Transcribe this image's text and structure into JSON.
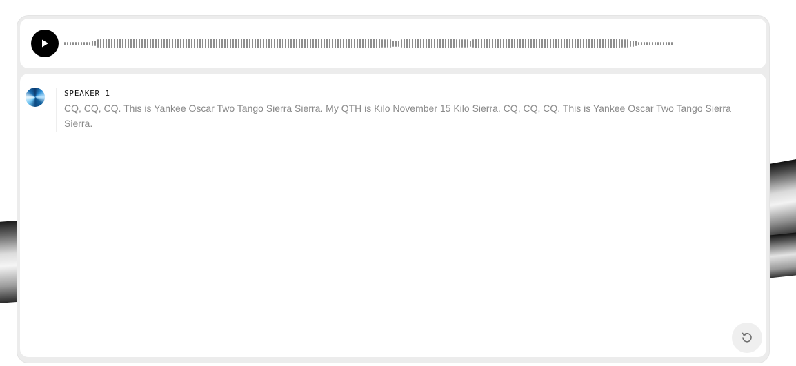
{
  "player": {
    "play_icon": "play-icon",
    "waveform": {
      "description_levels": [
        3,
        3,
        3,
        3,
        3,
        3,
        3,
        3,
        3,
        3,
        5,
        5,
        8,
        9,
        9,
        9,
        9,
        9,
        9,
        9,
        9,
        9,
        9,
        9,
        9,
        9,
        9,
        9,
        9,
        9,
        9,
        9,
        9,
        9,
        9,
        9,
        9,
        9,
        9,
        9,
        9,
        9,
        9,
        9,
        9,
        9,
        9,
        9,
        9,
        9,
        9,
        9,
        9,
        9,
        9,
        9,
        9,
        9,
        9,
        9,
        9,
        9,
        9,
        9,
        9,
        9,
        9,
        9,
        9,
        9,
        9,
        9,
        9,
        9,
        9,
        9,
        9,
        9,
        9,
        9,
        9,
        9,
        9,
        9,
        9,
        9,
        9,
        9,
        9,
        9,
        9,
        9,
        9,
        9,
        9,
        9,
        9,
        9,
        9,
        9,
        9,
        9,
        9,
        9,
        9,
        9,
        9,
        9,
        9,
        9,
        9,
        9,
        9,
        9,
        9,
        8,
        8,
        8,
        8,
        6,
        6,
        6,
        8,
        9,
        9,
        9,
        9,
        9,
        9,
        9,
        9,
        9,
        9,
        9,
        9,
        9,
        9,
        9,
        9,
        9,
        9,
        9,
        8,
        8,
        8,
        8,
        8,
        6,
        8,
        9,
        9,
        9,
        9,
        9,
        9,
        9,
        9,
        9,
        9,
        9,
        9,
        9,
        9,
        9,
        9,
        9,
        9,
        9,
        9,
        9,
        9,
        9,
        9,
        9,
        9,
        9,
        9,
        9,
        9,
        9,
        9,
        9,
        9,
        9,
        9,
        9,
        9,
        9,
        9,
        9,
        9,
        9,
        9,
        9,
        9,
        9,
        9,
        9,
        9,
        9,
        9,
        9,
        8,
        8,
        8,
        6,
        6,
        5,
        3,
        3,
        3,
        3,
        3,
        3,
        3,
        3,
        3,
        3,
        3,
        3,
        3
      ]
    }
  },
  "transcript": {
    "segments": [
      {
        "speaker": "SPEAKER 1",
        "text": "CQ, CQ, CQ. This is Yankee Oscar Two Tango Sierra Sierra. My QTH is Kilo November 15 Kilo Sierra. CQ, CQ, CQ. This is Yankee Oscar Two Tango Sierra Sierra."
      }
    ],
    "reset_icon": "reset-icon"
  }
}
